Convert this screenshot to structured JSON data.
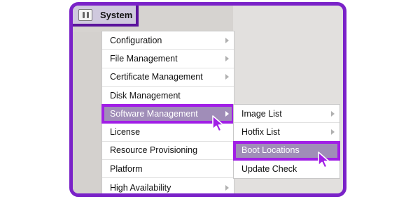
{
  "header": {
    "title": "System"
  },
  "menu": {
    "items": [
      {
        "label": "Configuration",
        "has_submenu": true
      },
      {
        "label": "File Management",
        "has_submenu": true
      },
      {
        "label": "Certificate Management",
        "has_submenu": true
      },
      {
        "label": "Disk Management",
        "has_submenu": false
      },
      {
        "label": "Software Management",
        "has_submenu": true,
        "active": true
      },
      {
        "label": "License",
        "has_submenu": false
      },
      {
        "label": "Resource Provisioning",
        "has_submenu": false
      },
      {
        "label": "Platform",
        "has_submenu": false
      },
      {
        "label": "High Availability",
        "has_submenu": true
      }
    ]
  },
  "submenu": {
    "items": [
      {
        "label": "Image List",
        "has_submenu": true
      },
      {
        "label": "Hotfix List",
        "has_submenu": true
      },
      {
        "label": "Boot Locations",
        "has_submenu": false,
        "active": true
      },
      {
        "label": "Update Check",
        "has_submenu": false
      }
    ]
  },
  "colors": {
    "highlight_outline": "#a11fe6",
    "frame": "#7a22c8",
    "active_item": "#a08db8"
  }
}
